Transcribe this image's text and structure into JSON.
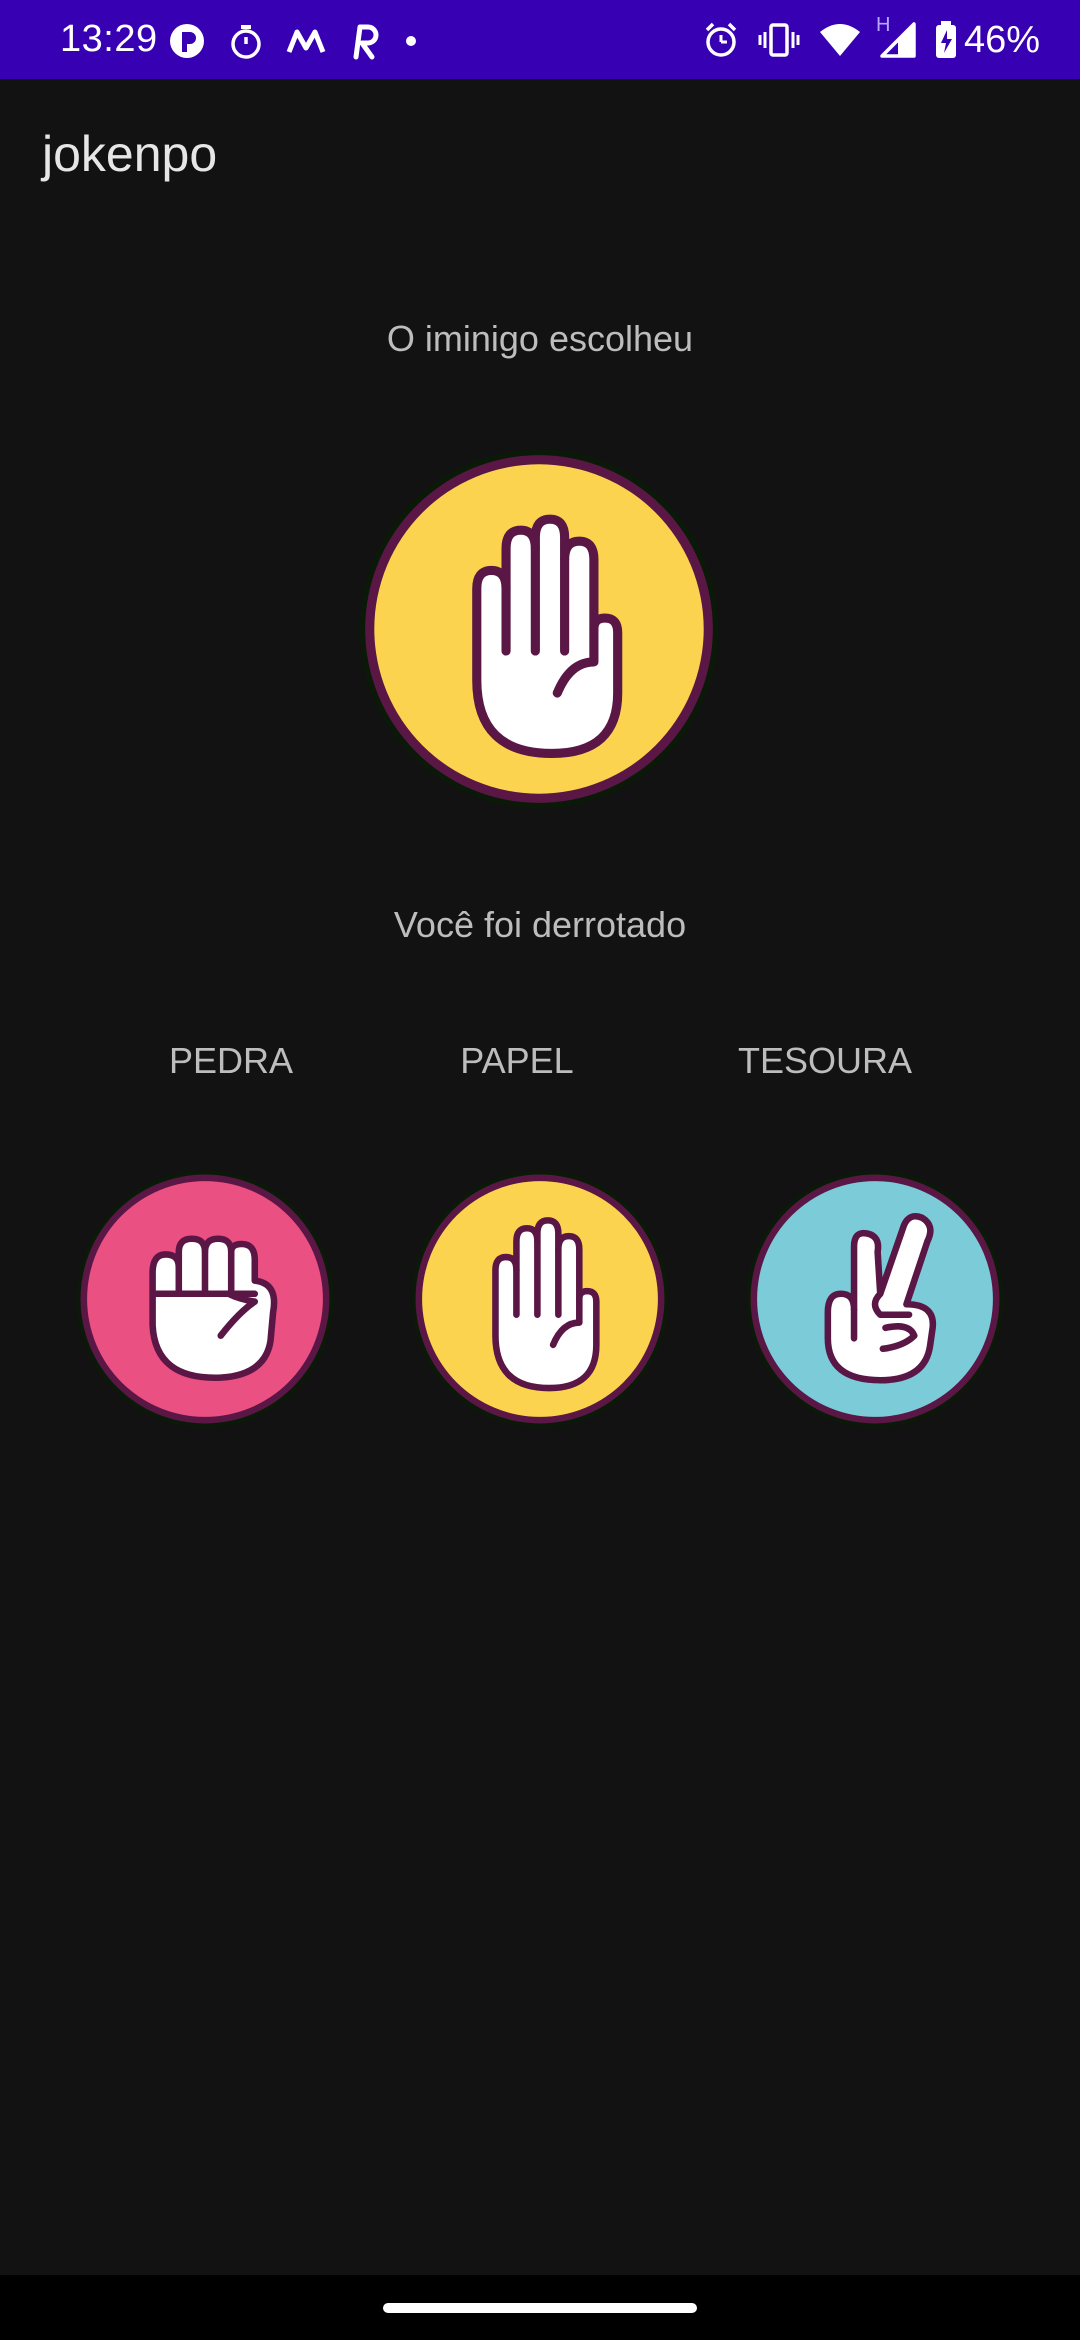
{
  "status_bar": {
    "time": "13:29",
    "battery": "46%",
    "network_type": "H",
    "left_icons": [
      "notification-app-icon",
      "stopwatch-icon",
      "m-app-icon",
      "r-app-icon",
      "dot-icon"
    ],
    "right_icons": [
      "alarm-icon",
      "vibrate-icon",
      "wifi-icon",
      "signal-icon",
      "battery-icon"
    ]
  },
  "app": {
    "title": "jokenpo"
  },
  "game": {
    "enemy_label": "O iminigo escolheu",
    "enemy_choice": "paper",
    "result_text": "Você foi derrotado"
  },
  "choices": [
    {
      "label": "PEDRA",
      "icon": "rock-hand-icon",
      "color": "#ea5082"
    },
    {
      "label": "PAPEL",
      "icon": "paper-hand-icon",
      "color": "#fcd34e"
    },
    {
      "label": "TESOURA",
      "icon": "scissors-hand-icon",
      "color": "#7ccbd8"
    }
  ],
  "colors": {
    "status_bar": "#3700b3",
    "background": "#121212",
    "hand_outline": "#5a1745"
  }
}
